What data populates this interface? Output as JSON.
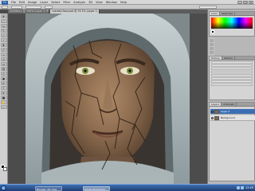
{
  "app": {
    "logo": "Ps"
  },
  "menubar": {
    "items": [
      "File",
      "Edit",
      "Image",
      "Layer",
      "Select",
      "Filter",
      "Analysis",
      "3D",
      "View",
      "Window",
      "Help"
    ]
  },
  "window_controls": {
    "minimize": "_",
    "maximize": "□",
    "close": "×"
  },
  "document_tabs": [
    {
      "label": "Untitled-1 @ 100% (Layer 1, RGB/8)",
      "active": false
    },
    {
      "label": "cracked-face.psd @ 33.3% (Layer 2, RGB/8)",
      "active": true
    }
  ],
  "toolbox": {
    "tools": [
      "move-tool",
      "marquee-tool",
      "lasso-tool",
      "quick-select-tool",
      "crop-tool",
      "eyedropper-tool",
      "healing-tool",
      "brush-tool",
      "clone-stamp-tool",
      "history-brush-tool",
      "eraser-tool",
      "gradient-tool",
      "blur-tool",
      "dodge-tool",
      "pen-tool",
      "type-tool",
      "path-select-tool",
      "shape-tool",
      "hand-tool",
      "zoom-tool"
    ],
    "foreground_color": "#000000",
    "background_color": "#ffffff"
  },
  "panels": {
    "color": {
      "tabs": [
        "Color",
        "Swatches"
      ]
    },
    "history": {
      "tabs": [
        "History",
        "Actions"
      ]
    },
    "layers": {
      "tabs": [
        "Layers",
        "Channels"
      ],
      "rows": [
        {
          "name": "Layer 2",
          "active": true
        },
        {
          "name": "Background",
          "active": false
        }
      ]
    }
  },
  "taskbar": {
    "buttons": [
      {
        "label": "Blogger: My blog",
        "active": false
      },
      {
        "label": "Adobe Photoshop",
        "active": true
      }
    ],
    "clock": "12:45"
  }
}
